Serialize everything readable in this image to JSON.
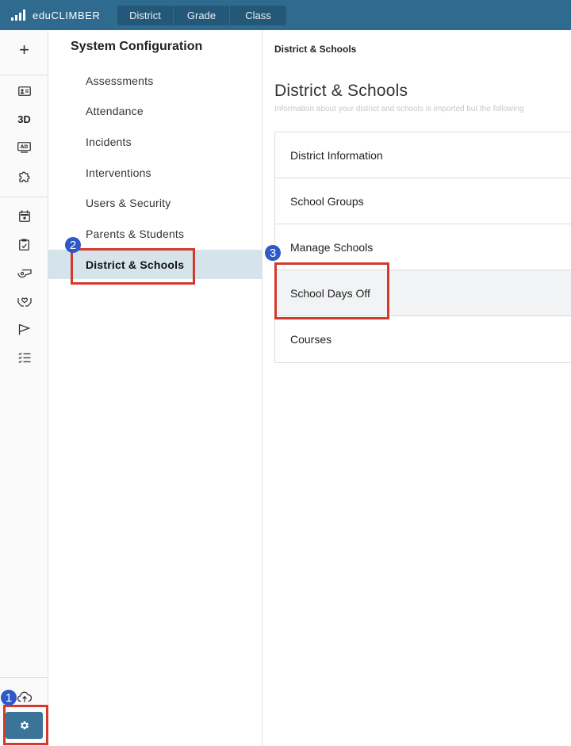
{
  "app": {
    "name": "eduCLIMBER"
  },
  "levels": [
    "District",
    "Grade",
    "Class"
  ],
  "rail": {
    "items": [
      "plus-icon",
      "id-card-icon",
      "3D",
      "ad-screen-icon",
      "puzzle-icon",
      "calendar-icon",
      "clipboard-icon",
      "whistle-icon",
      "helping-hands-icon",
      "flag-icon",
      "checklist-icon",
      "cloud-upload-icon",
      "gear-icon"
    ]
  },
  "config": {
    "title": "System Configuration",
    "items": [
      {
        "label": "Assessments"
      },
      {
        "label": "Attendance"
      },
      {
        "label": "Incidents"
      },
      {
        "label": "Interventions"
      },
      {
        "label": "Users & Security"
      },
      {
        "label": "Parents & Students"
      },
      {
        "label": "District & Schools",
        "active": true
      }
    ]
  },
  "main": {
    "breadcrumb": "District & Schools",
    "title": "District & Schools",
    "subtitle": "Information about your district and schools is imported but the following",
    "cards": [
      {
        "label": "District Information"
      },
      {
        "label": "School Groups"
      },
      {
        "label": "Manage Schools"
      },
      {
        "label": "School Days Off"
      },
      {
        "label": "Courses"
      }
    ]
  },
  "annotations": {
    "steps": [
      "1",
      "2",
      "3"
    ],
    "highlight_color": "#d23a2c",
    "badge_color": "#2f58c9"
  }
}
